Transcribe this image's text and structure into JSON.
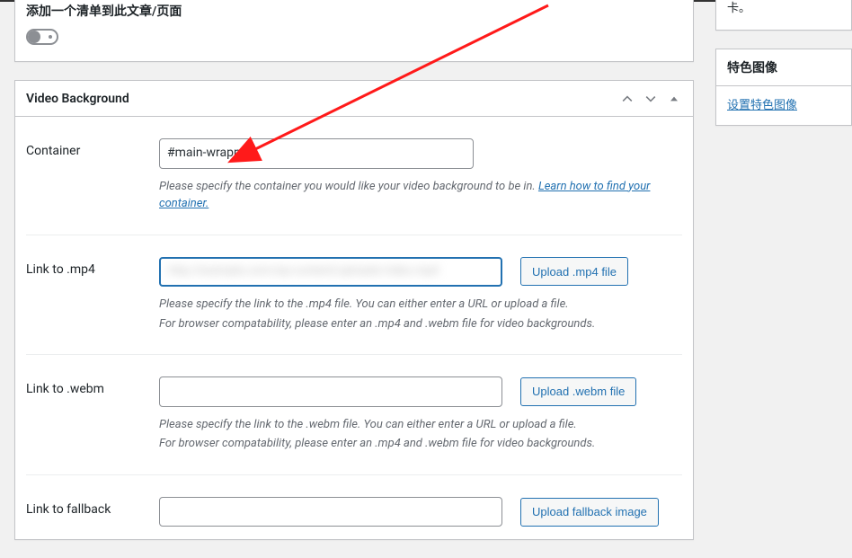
{
  "checklist_box": {
    "label": "添加一个清单到此文章/页面"
  },
  "vb_box": {
    "title": "Video Background",
    "fields": {
      "container": {
        "label": "Container",
        "value": "#main-wrapper",
        "help_prefix": "Please specify the container you would like your video background to be in. ",
        "link_text": "Learn how to find your container."
      },
      "mp4": {
        "label": "Link to .mp4",
        "value": "http://example.com/wp-content/uploads/video.mp4",
        "button": "Upload .mp4 file",
        "help1": "Please specify the link to the .mp4 file. You can either enter a URL or upload a file.",
        "help2": "For browser compatability, please enter an .mp4 and .webm file for video backgrounds."
      },
      "webm": {
        "label": "Link to .webm",
        "value": "",
        "button": "Upload .webm file",
        "help1": "Please specify the link to the .webm file. You can either enter a URL or upload a file.",
        "help2": "For browser compatability, please enter an .mp4 and .webm file for video backgrounds."
      },
      "fallback": {
        "label": "Link to fallback",
        "button": "Upload fallback image"
      }
    }
  },
  "sidebar": {
    "top_fragment": "卡。",
    "featured_image": {
      "title": "特色图像",
      "link": "设置特色图像"
    }
  }
}
